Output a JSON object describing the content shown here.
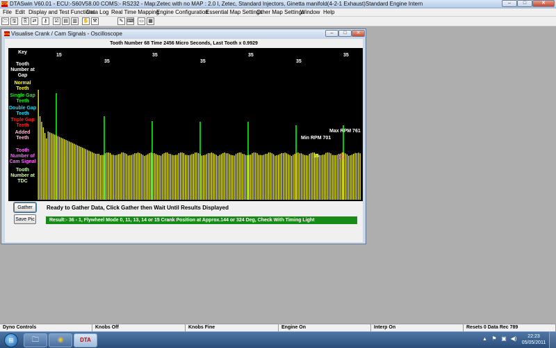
{
  "app": {
    "title": "DTASwin V60.01 - ECU:-S60V58.00 COMS:- RS232  - Map:Zetec with no MAP : 2.0 l, Zetec, Standard Injectors, Ginetta manifold(4-2-1 Exhaust)Standard Engine Intern",
    "icon_text": "DTA",
    "min_glyph": "–",
    "max_glyph": "□",
    "close_glyph": "✕"
  },
  "menu": [
    "File",
    "Edit",
    "Display and Test Functions",
    "Data Log",
    "Real Time Mapping",
    "Engine Configuration",
    "Essential Map Settings",
    "Other Map Settings",
    "Window",
    "Help"
  ],
  "toolbar": {
    "icons": [
      "open-file-icon",
      "save-file-icon",
      "copy-icon",
      "compare-icon",
      "key-icon",
      "checklist-icon",
      "disk-read-icon",
      "disk-write-icon",
      "hand-icon",
      "hammer-icon",
      "magic-wand-icon",
      "keyboard-icon",
      "cascade-window-icon",
      "tile-window-icon"
    ],
    "glyphs": [
      "🗁",
      "🖫",
      "⎘",
      "⇄",
      "⚷",
      "☑",
      "▤",
      "▥",
      "✋",
      "⚒",
      "✎",
      "⌨",
      "▭",
      "▦"
    ]
  },
  "osc": {
    "title": "Visualise Crank / Cam Signals - Oscilloscope",
    "icon_text": "DTA",
    "min_glyph": "–",
    "max_glyph": "□",
    "close_glyph": "✕",
    "tooth_info": "Tooth Number  68 Time 2456 Micro Seconds, Last Tooth x 0.9929",
    "key_title": "Key",
    "key_items": [
      {
        "label": "Tooth Number at Gap",
        "color": "#ffffff"
      },
      {
        "label": "Normal Teeth",
        "color": "#ffff00"
      },
      {
        "label": "Single Gap Teeth",
        "color": "#00ff00"
      },
      {
        "label": "Double Gap Teeth",
        "color": "#00e5ff"
      },
      {
        "label": "Triple Gap Teeth",
        "color": "#ff2020"
      },
      {
        "label": "Added Teeth",
        "color": "#ffbfd2"
      },
      {
        "label": "Tooth Number of Cam Signal",
        "color": "#ff66ff"
      },
      {
        "label": "Tooth Number at TDC",
        "color": "#ccff99"
      }
    ],
    "gap_labels": [
      "15",
      "35",
      "35",
      "35",
      "35",
      "35",
      "35"
    ],
    "max_rpm": "Max RPM 761",
    "min_rpm": "Min RPM 701",
    "tdc_label": "15",
    "cam_label": "33",
    "gather_label": "Gather",
    "savepic_label": "Save Pic",
    "ready_text": "Ready to Gather Data, Click Gather then Wait Until Results Displayed",
    "result_text": "Result:-  36 - 1, Flywheel Mode 0, 11, 13, 14 or 15 Crank Position at Approx.144 or 324 Deg, Check With Timing Light"
  },
  "chart_data": {
    "type": "bar",
    "description_series": "tooth time trace",
    "colors": {
      "normal": "#ffff00",
      "single_gap": "#00ff00",
      "background": "#000000"
    },
    "normal_tooth_count": 198,
    "gap_tooth_count": 7
  },
  "statusbar": [
    "Dyno Controls",
    "Knobs Off",
    "Knobs Fine",
    "Engine On",
    "Interp On",
    "Resets 0 Data Rec 789"
  ],
  "taskbar": {
    "start_glyph": "⊞",
    "apps": [
      {
        "name": "explorer-icon",
        "glyph": "🗀"
      },
      {
        "name": "chrome-icon",
        "glyph": "◉"
      },
      {
        "name": "dtaswin-icon",
        "glyph": "DTA"
      }
    ],
    "tray_up": "▲",
    "tray": [
      {
        "name": "flag-icon",
        "glyph": "⚑"
      },
      {
        "name": "network-icon",
        "glyph": "▣"
      },
      {
        "name": "volume-icon",
        "glyph": "◀)"
      }
    ],
    "time": "22:23",
    "date": "05/05/2011"
  }
}
